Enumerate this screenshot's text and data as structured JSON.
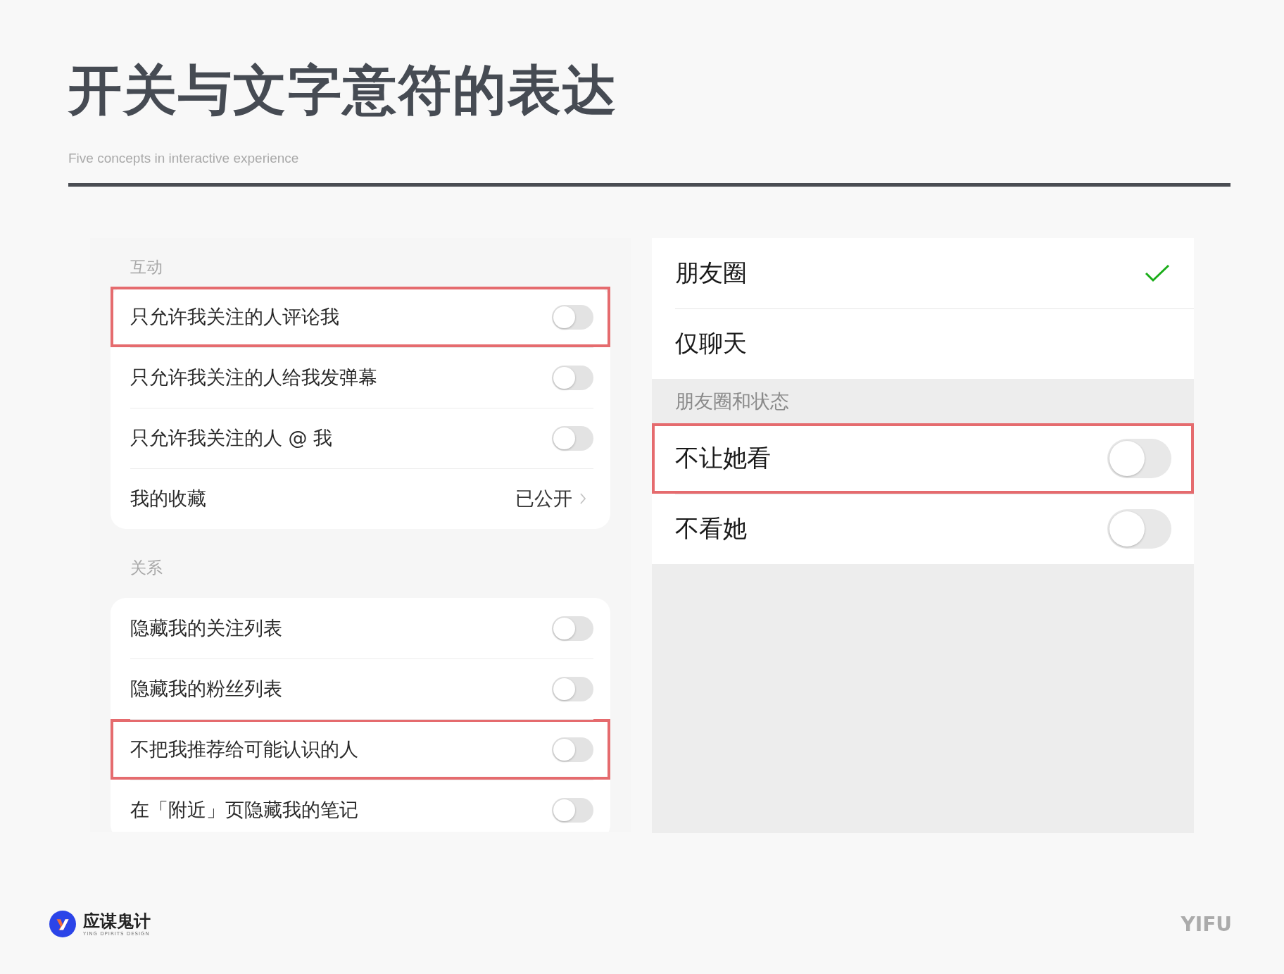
{
  "slide": {
    "title": "开关与文字意符的表达",
    "subtitle": "Five concepts in interactive experience"
  },
  "left_screen": {
    "sections": [
      {
        "title": "互动",
        "rows": [
          {
            "kind": "toggle",
            "label": "只允许我关注的人评论我",
            "on": false,
            "highlighted": true
          },
          {
            "kind": "toggle",
            "label": "只允许我关注的人给我发弹幕",
            "on": false,
            "highlighted": false
          },
          {
            "kind": "toggle",
            "label": "只允许我关注的人 @ 我",
            "on": false,
            "highlighted": false
          },
          {
            "kind": "link",
            "label": "我的收藏",
            "value": "已公开",
            "highlighted": false
          }
        ]
      },
      {
        "title": "关系",
        "rows": [
          {
            "kind": "toggle",
            "label": "隐藏我的关注列表",
            "on": false,
            "highlighted": false
          },
          {
            "kind": "toggle",
            "label": "隐藏我的粉丝列表",
            "on": false,
            "highlighted": false
          },
          {
            "kind": "toggle",
            "label": "不把我推荐给可能认识的人",
            "on": false,
            "highlighted": true
          },
          {
            "kind": "toggle",
            "label": "在「附近」页隐藏我的笔记",
            "on": false,
            "highlighted": false
          }
        ]
      }
    ]
  },
  "right_screen": {
    "items": [
      {
        "kind": "choice",
        "label": "朋友圈",
        "selected": true,
        "highlighted": false
      },
      {
        "kind": "choice",
        "label": "仅聊天",
        "selected": false,
        "highlighted": false
      },
      {
        "kind": "header",
        "label": "朋友圈和状态"
      },
      {
        "kind": "toggle",
        "label": "不让她看",
        "on": false,
        "highlighted": true
      },
      {
        "kind": "toggle",
        "label": "不看她",
        "on": false,
        "highlighted": false
      }
    ]
  },
  "footer": {
    "brand": "应谋鬼计",
    "brand_tagline": "YING DPIRITS DESIGN",
    "author": "YIFU"
  }
}
